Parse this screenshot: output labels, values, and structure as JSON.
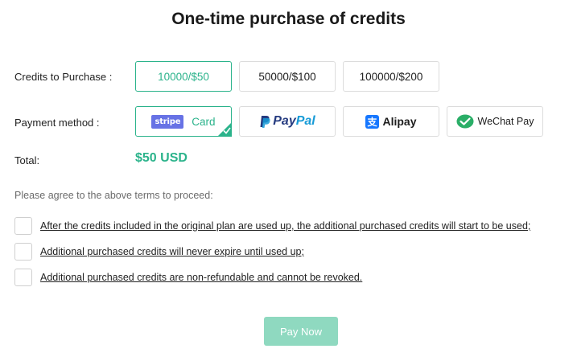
{
  "title": "One-time purchase of credits",
  "credits": {
    "label": "Credits to Purchase :",
    "options": [
      "10000/$50",
      "50000/$100",
      "100000/$200"
    ],
    "selected": "10000/$50"
  },
  "payment": {
    "label": "Payment method :",
    "stripe_badge": "stripe",
    "card_label": "Card",
    "paypal_part1": "Pay",
    "paypal_part2": "Pal",
    "alipay_label": "Alipay",
    "wechat_label": "WeChat Pay",
    "selected": "Card"
  },
  "total": {
    "label": "Total:",
    "value": "$50 USD"
  },
  "terms": {
    "prompt": "Please agree to the above terms to proceed:",
    "items": [
      "After the credits included in the original plan are used up, the additional purchased credits will start to be used;",
      "Additional purchased credits will never expire until used up;",
      "Additional purchased credits are non-refundable and cannot be revoked."
    ]
  },
  "pay_button": "Pay Now",
  "colors": {
    "accent": "#2bb38b",
    "button_disabled": "#8fd9c0",
    "stripe": "#6772e5",
    "paypal_dark": "#253b80",
    "paypal_light": "#179bd7",
    "alipay": "#1677ff",
    "wechat": "#2aae67"
  }
}
